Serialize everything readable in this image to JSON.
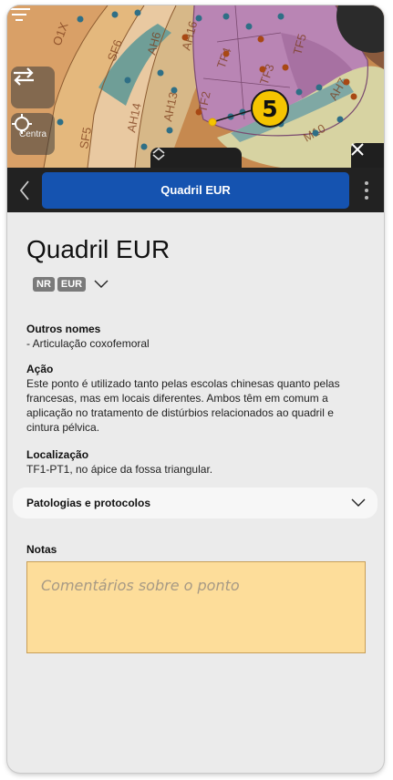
{
  "map": {
    "regions": [
      "O1X",
      "SF6",
      "AH6",
      "AH16",
      "TF5",
      "SF5",
      "AH14",
      "AH13",
      "TF2",
      "TF4",
      "TF3",
      "AH7",
      "M10"
    ],
    "point_badge": "5",
    "recenter_label": "Centra",
    "icons": {
      "swap": "swap-arrows-icon",
      "recenter": "crosshair-icon",
      "filter": "filter-icon",
      "grip": "chevron-up-down-icon",
      "close": "close-icon"
    }
  },
  "header": {
    "title": "Quadril EUR",
    "back_icon": "chevron-left-icon",
    "menu_icon": "kebab-menu-icon",
    "accent_color": "#1553b0"
  },
  "point": {
    "name": "Quadril EUR",
    "tags": [
      "NR",
      "EUR"
    ],
    "other_names_label": "Outros nomes",
    "other_names": "- Articulação coxofemoral",
    "action_label": "Ação",
    "action_text": "Este ponto é utilizado tanto pelas escolas chinesas quanto pelas francesas, mas em locais diferentes. Ambos têm em comum a aplicação no tratamento de distúrbios relacionados ao quadril e cintura pélvica.",
    "location_label": "Localização",
    "location_text": "TF1-PT1, no ápice da fossa triangular.",
    "pathologies_label": "Patologias e protocolos",
    "notes_label": "Notas",
    "notes_placeholder": "Comentários sobre o ponto"
  }
}
